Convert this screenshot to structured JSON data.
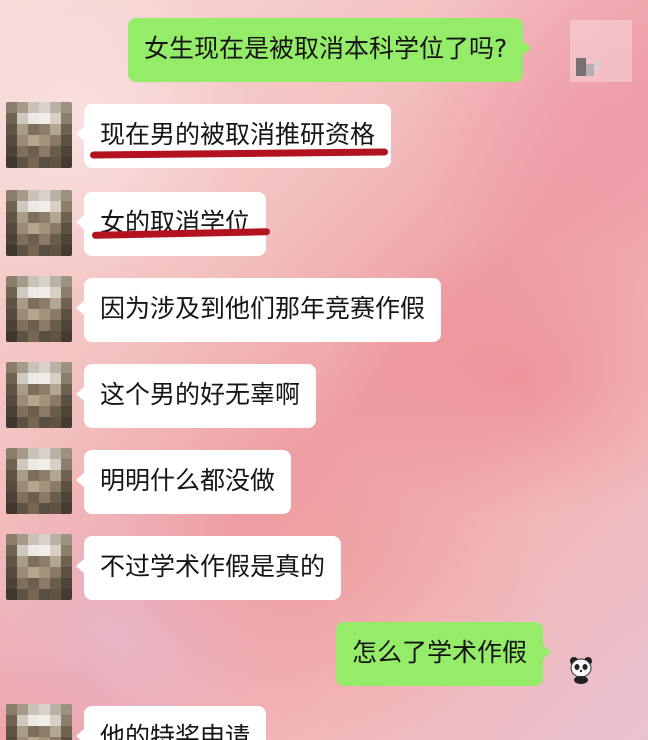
{
  "chat": {
    "messages": [
      {
        "sender": "self",
        "text": "女生现在是被取消本科学位了吗?"
      },
      {
        "sender": "other",
        "text": "现在男的被取消推研资格",
        "underlined": true
      },
      {
        "sender": "other",
        "text": "女的取消学位",
        "underlined": true
      },
      {
        "sender": "other",
        "text": "因为涉及到他们那年竞赛作假"
      },
      {
        "sender": "other",
        "text": "这个男的好无辜啊"
      },
      {
        "sender": "other",
        "text": "明明什么都没做"
      },
      {
        "sender": "other",
        "text": "不过学术作假是真的"
      },
      {
        "sender": "self",
        "text": "怎么了学术作假"
      },
      {
        "sender": "other",
        "text": "他的特奖申请"
      }
    ]
  },
  "colors": {
    "self_bubble": "#95ec69",
    "other_bubble": "#ffffff",
    "underline": "#b3121f"
  }
}
